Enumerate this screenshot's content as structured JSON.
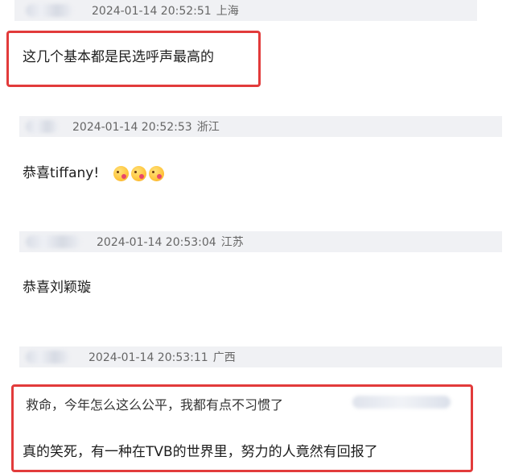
{
  "comments": [
    {
      "timestamp": "2024-01-14 20:52:51",
      "location": "上海",
      "text": "这几个基本都是民选呼声最高的",
      "highlighted": true
    },
    {
      "timestamp": "2024-01-14 20:52:53",
      "location": "浙江",
      "text": "恭喜tiffany!",
      "emoji": [
        "kiss-face-emoji",
        "kiss-face-emoji",
        "kiss-face-emoji"
      ],
      "highlighted": false
    },
    {
      "timestamp": "2024-01-14 20:53:04",
      "location": "江苏",
      "text": "恭喜刘颖璇",
      "highlighted": false
    },
    {
      "timestamp": "2024-01-14 20:53:11",
      "location": "广西",
      "quote": "救命，今年怎么这么公平，我都有点不习惯了",
      "text": "真的笑死，有一种在TVB的世界里，努力的人竟然有回报了",
      "highlighted": true
    }
  ],
  "colors": {
    "highlight_border": "#e23b3b",
    "header_bg": "#f0f1f4",
    "meta_text": "#666666"
  }
}
